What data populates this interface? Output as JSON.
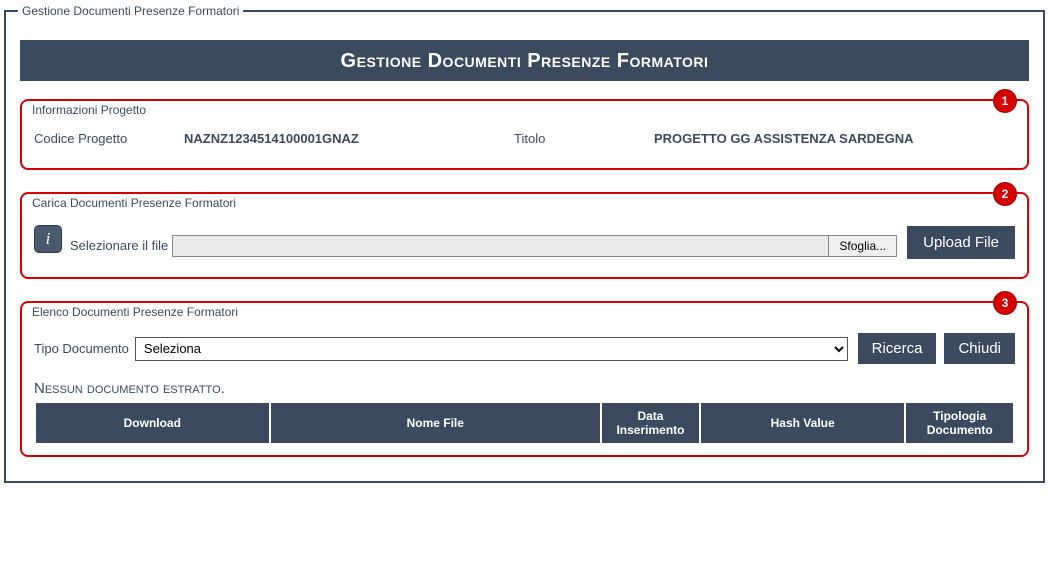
{
  "outer_legend": "Gestione Documenti Presenze Formatori",
  "title": "Gestione Documenti Presenze Formatori",
  "callouts": {
    "info": "1",
    "upload": "2",
    "list": "3"
  },
  "info": {
    "legend": "Informazioni Progetto",
    "code_label": "Codice Progetto",
    "code_value": "NAZNZ1234514100001GNAZ",
    "title_label": "Titolo",
    "title_value": "PROGETTO GG ASSISTENZA SARDEGNA"
  },
  "upload": {
    "legend": "Carica Documenti Presenze Formatori",
    "select_label": "Selezionare il file",
    "browse_label": "Sfoglia...",
    "upload_label": "Upload File",
    "file_path": ""
  },
  "list": {
    "legend": "Elenco Documenti Presenze Formatori",
    "type_label": "Tipo Documento",
    "type_selected": "Seleziona",
    "search_label": "Ricerca",
    "close_label": "Chiudi",
    "empty_message": "Nessun documento estratto.",
    "columns": {
      "download": "Download",
      "name": "Nome File",
      "date": "Data Inserimento",
      "hash": "Hash Value",
      "type": "Tipologia Documento"
    }
  }
}
